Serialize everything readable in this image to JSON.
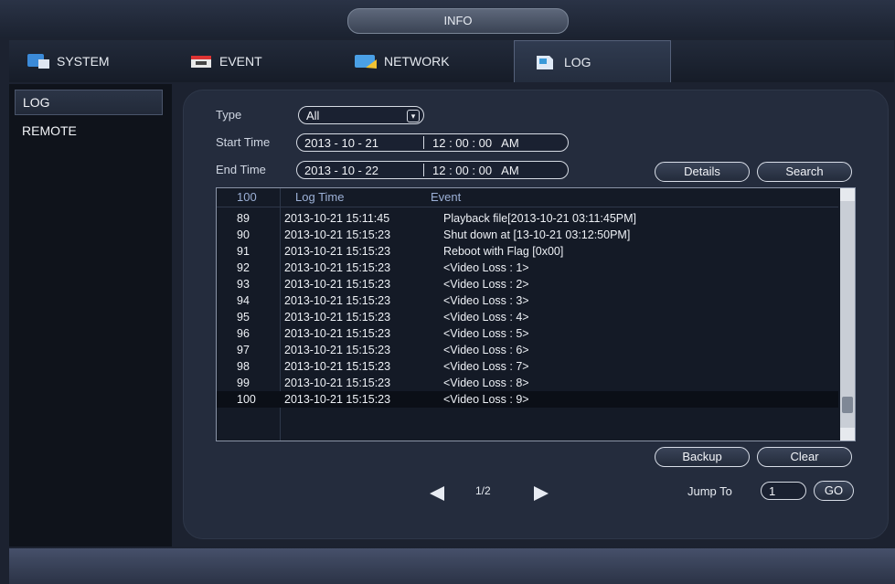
{
  "window": {
    "title": "INFO"
  },
  "tabs": [
    {
      "label": "SYSTEM",
      "icon": "system-icon"
    },
    {
      "label": "EVENT",
      "icon": "event-icon"
    },
    {
      "label": "NETWORK",
      "icon": "network-icon"
    },
    {
      "label": "LOG",
      "icon": "log-icon"
    }
  ],
  "sidebar": {
    "items": [
      {
        "label": "LOG"
      },
      {
        "label": "REMOTE"
      }
    ]
  },
  "filters": {
    "type_label": "Type",
    "type_value": "All",
    "start_label": "Start Time",
    "start_date": "2013 - 10 - 21",
    "start_time": "12 : 00 : 00   AM",
    "end_label": "End Time",
    "end_date": "2013 - 10 - 22",
    "end_time": "12 : 00 : 00   AM"
  },
  "buttons": {
    "details": "Details",
    "search": "Search",
    "backup": "Backup",
    "clear": "Clear",
    "go": "GO"
  },
  "table": {
    "headers": {
      "index": "100",
      "time": "Log Time",
      "event": "Event"
    },
    "rows": [
      {
        "index": "89",
        "time": "2013-10-21 15:11:45",
        "event": "Playback file[2013-10-21 03:11:45PM]"
      },
      {
        "index": "90",
        "time": "2013-10-21 15:15:23",
        "event": "Shut down at [13-10-21 03:12:50PM]"
      },
      {
        "index": "91",
        "time": "2013-10-21 15:15:23",
        "event": "Reboot with Flag [0x00]"
      },
      {
        "index": "92",
        "time": "2013-10-21 15:15:23",
        "event": "<Video Loss : 1>"
      },
      {
        "index": "93",
        "time": "2013-10-21 15:15:23",
        "event": "<Video Loss : 2>"
      },
      {
        "index": "94",
        "time": "2013-10-21 15:15:23",
        "event": "<Video Loss : 3>"
      },
      {
        "index": "95",
        "time": "2013-10-21 15:15:23",
        "event": "<Video Loss : 4>"
      },
      {
        "index": "96",
        "time": "2013-10-21 15:15:23",
        "event": "<Video Loss : 5>"
      },
      {
        "index": "97",
        "time": "2013-10-21 15:15:23",
        "event": "<Video Loss : 6>"
      },
      {
        "index": "98",
        "time": "2013-10-21 15:15:23",
        "event": "<Video Loss : 7>"
      },
      {
        "index": "99",
        "time": "2013-10-21 15:15:23",
        "event": "<Video Loss : 8>"
      },
      {
        "index": "100",
        "time": "2013-10-21 15:15:23",
        "event": "<Video Loss : 9>"
      }
    ]
  },
  "pagination": {
    "page": "1/2",
    "jump_label": "Jump To",
    "jump_value": "1"
  },
  "colors": {
    "background": "#1c2230",
    "panel": "#242c3d",
    "header_text": "#9cb0d6"
  }
}
